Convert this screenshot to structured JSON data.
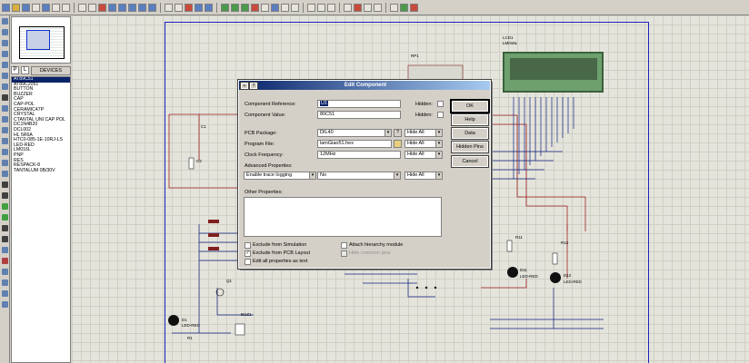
{
  "devices": {
    "header_p": "P",
    "header_l": "L",
    "title": "DEVICES",
    "items": [
      "AT89C51",
      "AT89C2051",
      "BUTTON",
      "BUZZER",
      "CAP",
      "CAP-POL",
      "CERAMIC47P",
      "CRYSTAL",
      "CTANTAL UNI CAP POL",
      "DC1N4B20",
      "DCL002",
      "HL 5R6A",
      "HTC0-085-1E-10RJ-LS",
      "LED-RED",
      "LM016L",
      "PNP",
      "RES",
      "RESPACK-8",
      "TANTALUM 0B/30V"
    ],
    "selected_index": 0
  },
  "schematic": {
    "lcd_ref": "LCD1",
    "lcd_model": "LM016L",
    "rp_ref": "RP1",
    "c1": "C1",
    "c2": "C2",
    "d1": "D1",
    "d1_model": "LED-RED",
    "d11": "D11",
    "d11_model": "LED-RED",
    "d12": "D12",
    "d12_model": "LED-RED",
    "r11": "R11",
    "r12": "R12",
    "q1": "Q1",
    "bz1": "BUZ1",
    "r1": "R1"
  },
  "dialog": {
    "title": "Edit Component",
    "component_reference_label": "Component Reference:",
    "component_reference_value": "U1",
    "component_value_label": "Component Value:",
    "component_value_value": "80C51",
    "hidden_label_1": "Hidden:",
    "hidden_label_2": "Hidden:",
    "pcb_package_label": "PCB Package:",
    "pcb_package_value": "DIL40",
    "program_file_label": "Program File:",
    "program_file_value": "lamGiao51.hex",
    "clock_frequency_label": "Clock Frequency:",
    "clock_frequency_value": "12MHz",
    "hide_all_1": "Hide All",
    "hide_all_2": "Hide All",
    "hide_all_3": "Hide All",
    "hide_all_4": "Hide All",
    "advanced_properties_label": "Advanced Properties:",
    "advanced_property_name": "Enable trace logging",
    "advanced_property_value": "No",
    "other_properties_label": "Other Properties:",
    "exclude_simulation": "Exclude from Simulation",
    "exclude_pcb": "Exclude from PCB Layout",
    "edit_all_props": "Edit all properties as text",
    "attach_hierarchy": "Attach hierarchy module",
    "hide_common_pins": "Hide common pins",
    "ok": "OK",
    "help": "Help",
    "data": "Data",
    "hidden_pins": "Hidden Pins",
    "cancel": "Cancel",
    "question_btn": "?"
  }
}
